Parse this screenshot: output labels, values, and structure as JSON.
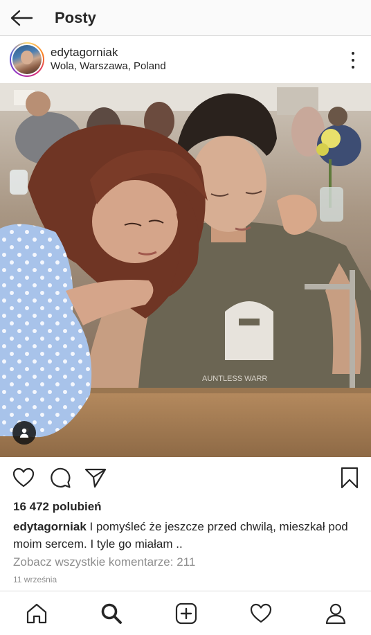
{
  "topbar": {
    "title": "Posty",
    "back_icon": "arrow-left-icon"
  },
  "post": {
    "username": "edytagorniak",
    "location": "Wola, Warszawa, Poland",
    "likes": "16 472 polubień",
    "caption_user": "edytagorniak",
    "caption_text": " I pomyśleć że jeszcze przed chwilą, mieszkał pod moim sercem. I tyle go miałam ..",
    "view_comments": "Zobacz wszystkie komentarze: 211",
    "date": "11 września",
    "shirt_text": "AUNTLESS WARR"
  },
  "actions": {
    "icons": [
      "heart-icon",
      "comment-icon",
      "share-icon",
      "bookmark-icon"
    ]
  },
  "bottom_nav": {
    "items": [
      "home-icon",
      "search-icon",
      "add-post-icon",
      "activity-heart-icon",
      "profile-icon"
    ]
  },
  "colors": {
    "text": "#262626",
    "secondary": "#8e8e8e",
    "divider": "#dbdbdb",
    "topbar_bg": "#fafafa"
  }
}
